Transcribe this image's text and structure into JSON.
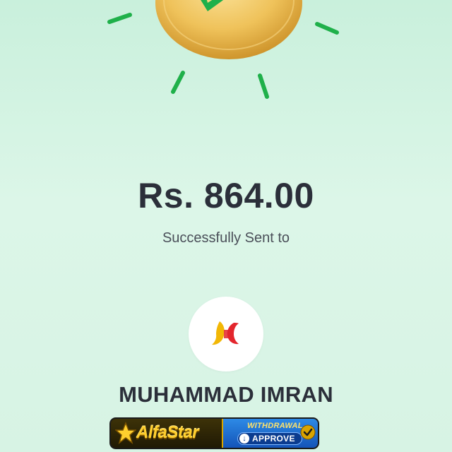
{
  "payment": {
    "amount": "Rs. 864.00",
    "status_text": "Successfully Sent to"
  },
  "recipient": {
    "name": "MUHAMMAD IMRAN",
    "bank_logo_icon": "jazzcash-logo-icon"
  },
  "banner": {
    "brand": "AlfaStar",
    "withdrawal_label": "WITHDRAWAL",
    "approve_label": "APPROVE"
  },
  "icons": {
    "hero": "success-coin-check-icon",
    "approve": "download-arrow-icon",
    "seal": "check-seal-icon"
  },
  "colors": {
    "background": "#d7f3e4",
    "text_primary": "#2b2f3a",
    "text_secondary": "#4a4f59",
    "accent_green": "#1fb04a",
    "coin_gold": "#e8b94a"
  }
}
